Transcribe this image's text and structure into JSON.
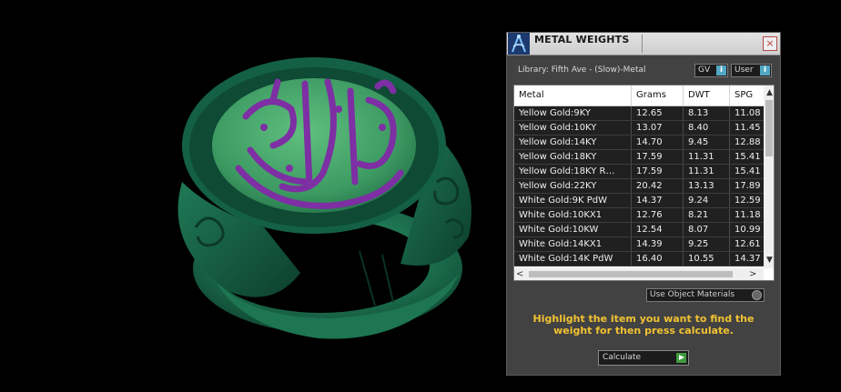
{
  "panel": {
    "title": "METAL WEIGHTS",
    "close_glyph": "×",
    "library_label": "Library: Fifth Ave - (Slow)-Metal",
    "gv_label": "GV",
    "user_label": "User",
    "info_glyph": "i"
  },
  "table": {
    "columns": [
      "Metal",
      "Grams",
      "DWT",
      "SPG"
    ],
    "rows": [
      {
        "metal": "Yellow Gold:9KY",
        "grams": "12.65",
        "dwt": "8.13",
        "spg": "11.08"
      },
      {
        "metal": "Yellow Gold:10KY",
        "grams": "13.07",
        "dwt": "8.40",
        "spg": "11.45"
      },
      {
        "metal": "Yellow Gold:14KY",
        "grams": "14.70",
        "dwt": "9.45",
        "spg": "12.88"
      },
      {
        "metal": "Yellow Gold:18KY",
        "grams": "17.59",
        "dwt": "11.31",
        "spg": "15.41"
      },
      {
        "metal": "Yellow Gold:18KY R…",
        "grams": "17.59",
        "dwt": "11.31",
        "spg": "15.41"
      },
      {
        "metal": "Yellow Gold:22KY",
        "grams": "20.42",
        "dwt": "13.13",
        "spg": "17.89"
      },
      {
        "metal": "White Gold:9K PdW",
        "grams": "14.37",
        "dwt": "9.24",
        "spg": "12.59"
      },
      {
        "metal": "White Gold:10KX1",
        "grams": "12.76",
        "dwt": "8.21",
        "spg": "11.18"
      },
      {
        "metal": "White Gold:10KW",
        "grams": "12.54",
        "dwt": "8.07",
        "spg": "10.99"
      },
      {
        "metal": "White Gold:14KX1",
        "grams": "14.39",
        "dwt": "9.25",
        "spg": "12.61"
      },
      {
        "metal": "White Gold:14K PdW",
        "grams": "16.40",
        "dwt": "10.55",
        "spg": "14.37"
      }
    ],
    "scroll_up_glyph": "▲",
    "scroll_down_glyph": "▼",
    "scroll_left_glyph": "<",
    "scroll_right_glyph": ">"
  },
  "use_object_materials_label": "Use Object Materials",
  "instructions": "Highlight the item you want to find the weight for then press calculate.",
  "calculate_label": "Calculate",
  "colors": {
    "ring_green": "#1f7a56",
    "calligraphy_purple": "#7d2fa3",
    "panel_bg": "#424242",
    "instruction_yellow": "#f1c232",
    "row_bg": "#202020"
  },
  "icons": {
    "logo": "compass-logo-icon",
    "close": "close-icon",
    "info": "info-icon",
    "play": "play-icon"
  }
}
